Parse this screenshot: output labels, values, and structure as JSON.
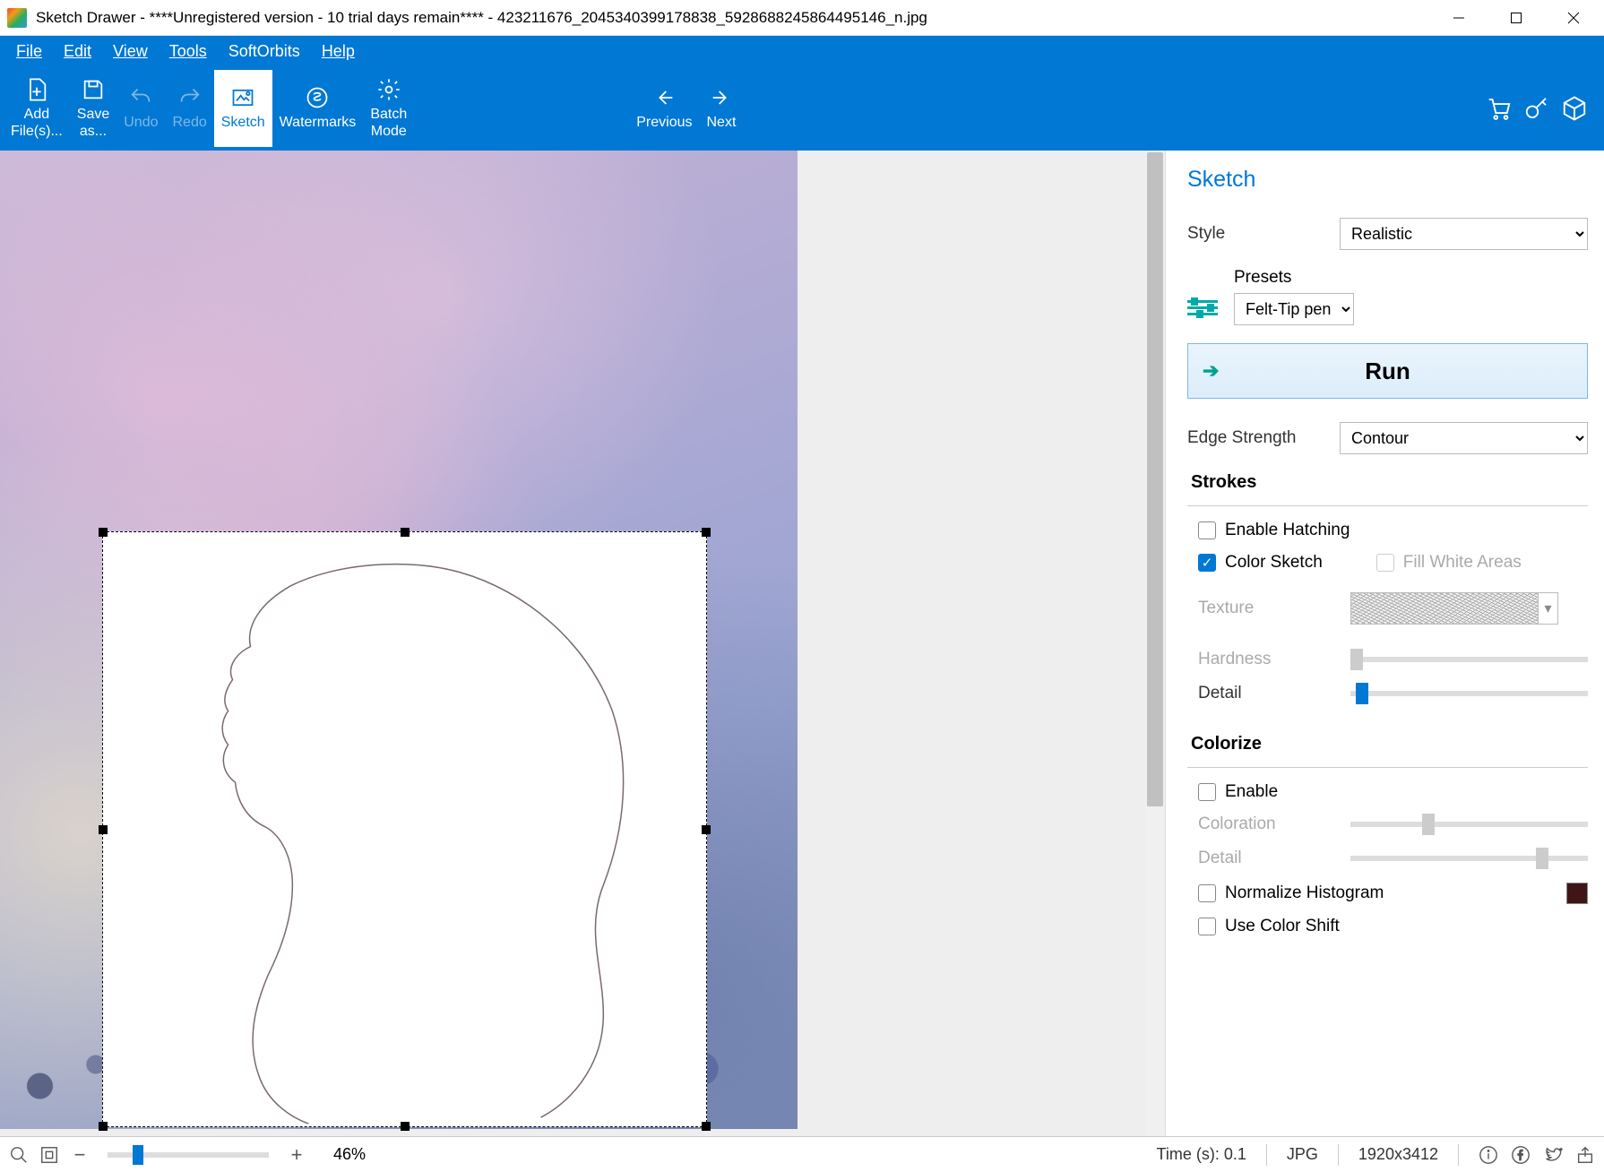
{
  "title": "Sketch Drawer - ****Unregistered version - 10 trial days remain**** - 423211676_2045340399178838_5928688245864495146_n.jpg",
  "menu": {
    "file": "File",
    "edit": "Edit",
    "view": "View",
    "tools": "Tools",
    "softorbits": "SoftOrbits",
    "help": "Help"
  },
  "toolbar": {
    "add": "Add\nFile(s)...",
    "save": "Save\nas...",
    "undo": "Undo",
    "redo": "Redo",
    "sketch": "Sketch",
    "watermarks": "Watermarks",
    "batch": "Batch\nMode",
    "prev": "Previous",
    "next": "Next"
  },
  "panel": {
    "title": "Sketch",
    "style_label": "Style",
    "style_value": "Realistic",
    "presets_label": "Presets",
    "presets_value": "Felt-Tip pen",
    "run": "Run",
    "edge_label": "Edge Strength",
    "edge_value": "Contour",
    "strokes": {
      "title": "Strokes",
      "hatching": "Enable Hatching",
      "color_sketch": "Color Sketch",
      "fill_white": "Fill White Areas",
      "texture": "Texture",
      "hardness": "Hardness",
      "detail": "Detail"
    },
    "colorize": {
      "title": "Colorize",
      "enable": "Enable",
      "coloration": "Coloration",
      "detail": "Detail",
      "normalize": "Normalize Histogram",
      "shift": "Use Color Shift"
    }
  },
  "status": {
    "zoom": "46%",
    "time": "Time (s): 0.1",
    "format": "JPG",
    "dims": "1920x3412"
  }
}
